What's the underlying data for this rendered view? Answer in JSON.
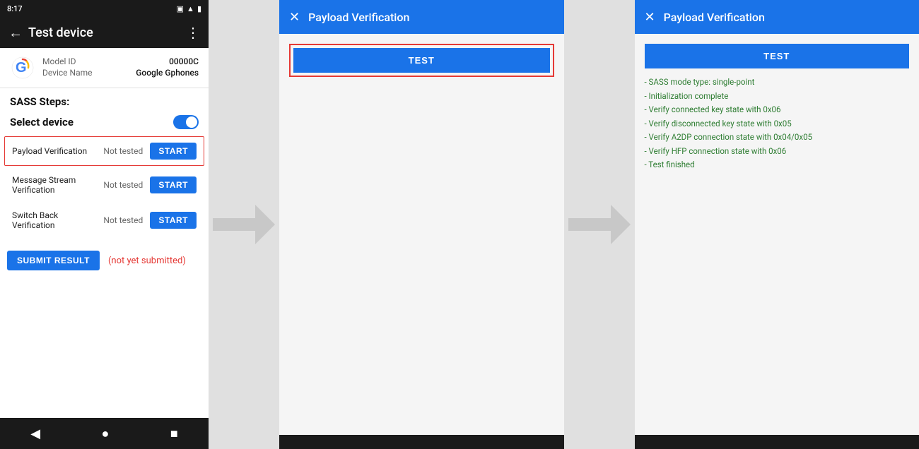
{
  "phone": {
    "status_bar": {
      "time": "8:17",
      "icons": "status icons"
    },
    "top_bar": {
      "title": "Test device",
      "back_label": "←",
      "more_label": "⋮"
    },
    "device_info": {
      "model_id_label": "Model ID",
      "model_id_value": "00000C",
      "device_name_label": "Device Name",
      "device_name_value": "Google Gphones"
    },
    "sass_steps_label": "SASS Steps:",
    "select_device_label": "Select device",
    "steps": [
      {
        "name": "Payload Verification",
        "status": "Not tested",
        "start_label": "START",
        "highlighted": true
      },
      {
        "name": "Message Stream Verification",
        "status": "Not tested",
        "start_label": "START",
        "highlighted": false
      },
      {
        "name": "Switch Back Verification",
        "status": "Not tested",
        "start_label": "START",
        "highlighted": false
      }
    ],
    "submit_btn_label": "SUBMIT RESULT",
    "not_submitted_label": "(not yet submitted)",
    "nav": {
      "back": "◀",
      "home": "●",
      "square": "■"
    }
  },
  "dialog1": {
    "header": {
      "close_label": "✕",
      "title": "Payload Verification"
    },
    "test_btn_label": "TEST"
  },
  "dialog2": {
    "header": {
      "close_label": "✕",
      "title": "Payload Verification"
    },
    "test_btn_label": "TEST",
    "result_lines": [
      "- SASS mode type: single-point",
      "- Initialization complete",
      "- Verify connected key state with 0x06",
      "- Verify disconnected key state with 0x05",
      "- Verify A2DP connection state with 0x04/0x05",
      "- Verify HFP connection state with 0x06",
      "- Test finished"
    ]
  }
}
